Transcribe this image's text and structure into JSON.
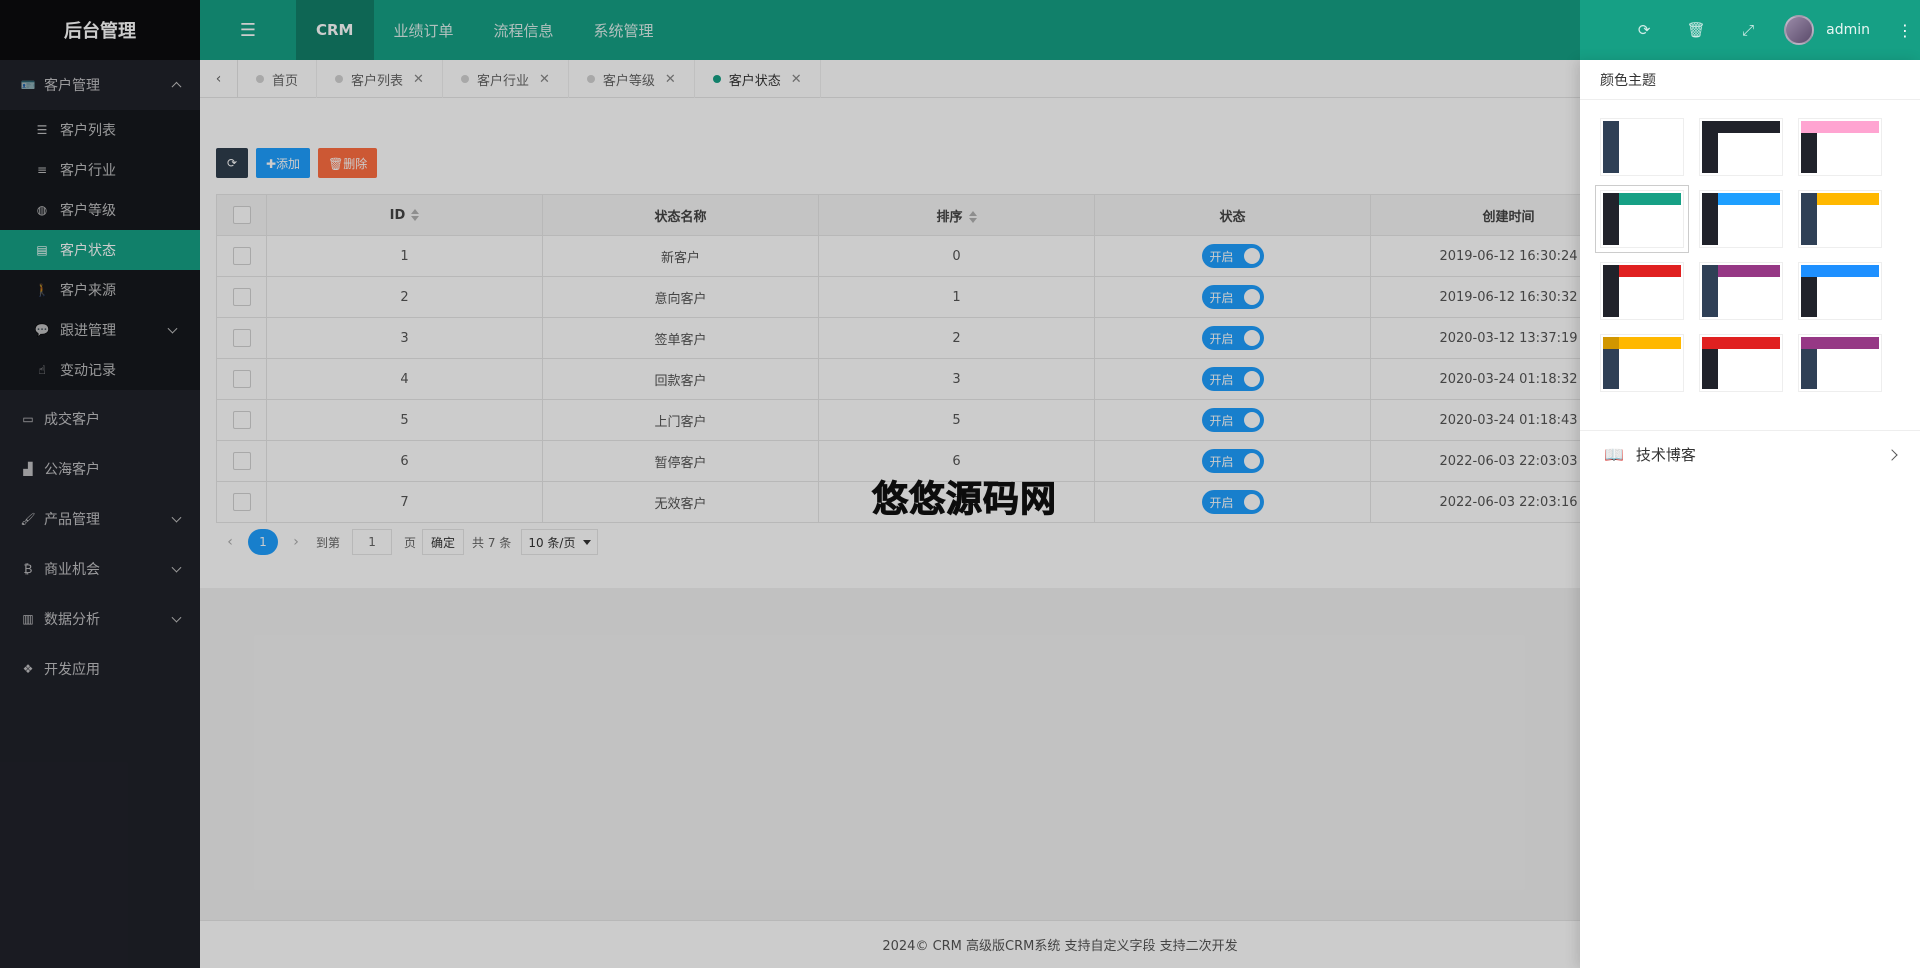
{
  "sidebar": {
    "logo": "后台管理",
    "items": [
      {
        "label": "客户管理",
        "icon": "id-card-icon",
        "expanded": true,
        "children": [
          {
            "label": "客户列表",
            "icon": "list-icon"
          },
          {
            "label": "客户行业",
            "icon": "align-center-icon"
          },
          {
            "label": "客户等级",
            "icon": "dribbble-icon"
          },
          {
            "label": "客户状态",
            "icon": "address-card-icon",
            "active": true
          },
          {
            "label": "客户来源",
            "icon": "walk-icon"
          },
          {
            "label": "跟进管理",
            "icon": "comments-icon",
            "has_arrow": true
          },
          {
            "label": "变动记录",
            "icon": "hand-icon"
          }
        ]
      },
      {
        "label": "成交客户",
        "icon": "vcard-icon"
      },
      {
        "label": "公海客户",
        "icon": "industry-icon"
      },
      {
        "label": "产品管理",
        "icon": "paint-brush-icon"
      },
      {
        "label": "商业机会",
        "icon": "bitcoin-icon"
      },
      {
        "label": "数据分析",
        "icon": "bar-chart-icon"
      },
      {
        "label": "开发应用",
        "icon": "cubes-icon"
      }
    ]
  },
  "header": {
    "menus": [
      "CRM",
      "业绩订单",
      "流程信息",
      "系统管理"
    ],
    "active_menu": "CRM",
    "username": "admin",
    "accent_color": "#16a085"
  },
  "tabs": [
    {
      "label": "首页",
      "closable": false
    },
    {
      "label": "客户列表",
      "closable": true
    },
    {
      "label": "客户行业",
      "closable": true
    },
    {
      "label": "客户等级",
      "closable": true
    },
    {
      "label": "客户状态",
      "closable": true,
      "active": true
    }
  ],
  "toolbar": {
    "add_label": "✚添加",
    "delete_label": "🗑删除"
  },
  "table": {
    "columns": [
      "ID",
      "状态名称",
      "排序",
      "状态",
      "创建时间"
    ],
    "switch_on_label": "开启",
    "rows": [
      {
        "id": "1",
        "name": "新客户",
        "sort": "0",
        "status": "开启",
        "created": "2019-06-12 16:30:24"
      },
      {
        "id": "2",
        "name": "意向客户",
        "sort": "1",
        "status": "开启",
        "created": "2019-06-12 16:30:32"
      },
      {
        "id": "3",
        "name": "签单客户",
        "sort": "2",
        "status": "开启",
        "created": "2020-03-12 13:37:19"
      },
      {
        "id": "4",
        "name": "回款客户",
        "sort": "3",
        "status": "开启",
        "created": "2020-03-24 01:18:32"
      },
      {
        "id": "5",
        "name": "上门客户",
        "sort": "5",
        "status": "开启",
        "created": "2020-03-24 01:18:43"
      },
      {
        "id": "6",
        "name": "暂停客户",
        "sort": "6",
        "status": "开启",
        "created": "2022-06-03 22:03:03"
      },
      {
        "id": "7",
        "name": "无效客户",
        "sort": "7",
        "status": "开启",
        "created": "2022-06-03 22:03:16"
      }
    ]
  },
  "pager": {
    "current_page": "1",
    "goto_label": "到第",
    "goto_value": "1",
    "page_suffix": "页",
    "confirm_label": "确定",
    "total_label": "共 7 条",
    "page_size_label": "10 条/页"
  },
  "watermark": "悠悠源码网",
  "footer": "2024© CRM 高级版CRM系统 支持自定义字段 支持二次开发",
  "theme_panel": {
    "title": "颜色主题",
    "blog_link": "技术博客",
    "themes": [
      {
        "logo": "#2f4056",
        "header": "#ffffff",
        "side": "#2f4056"
      },
      {
        "logo": "#20222a",
        "header": "#20222a",
        "side": "#20222a"
      },
      {
        "logo": "#ffa4d1",
        "header": "#ffa4d1",
        "side": "#20222a"
      },
      {
        "logo": "#20222a",
        "header": "#16a085",
        "side": "#20222a",
        "selected": true
      },
      {
        "logo": "#20222a",
        "header": "#1e9fff",
        "side": "#20222a"
      },
      {
        "logo": "#2f4056",
        "header": "#ffb800",
        "side": "#2f4056"
      },
      {
        "logo": "#20222a",
        "header": "#e02020",
        "side": "#20222a"
      },
      {
        "logo": "#2f4056",
        "header": "#963885",
        "side": "#2f4056"
      },
      {
        "logo": "#1e90ff",
        "header": "#1e90ff",
        "side": "#20222a"
      },
      {
        "logo": "#d19600",
        "header": "#ffb800",
        "side": "#2f4056"
      },
      {
        "logo": "#e02020",
        "header": "#e02020",
        "side": "#20222a"
      },
      {
        "logo": "#963885",
        "header": "#963885",
        "side": "#2f4056"
      }
    ]
  }
}
